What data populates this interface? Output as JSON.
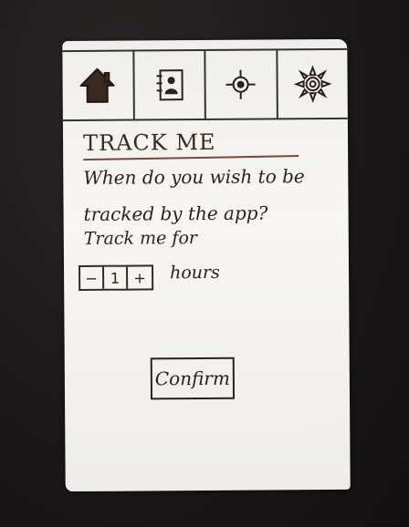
{
  "tabs": [
    {
      "icon": "home-icon"
    },
    {
      "icon": "address-book-icon"
    },
    {
      "icon": "location-target-icon"
    },
    {
      "icon": "settings-gear-icon"
    }
  ],
  "page": {
    "title": "TRACK ME",
    "question_line1": "When do you wish to be",
    "question_line2": "tracked by the app?",
    "track_label": "Track me for",
    "stepper": {
      "decrement": "−",
      "value": "1",
      "increment": "+"
    },
    "unit_label": "hours",
    "confirm_label": "Confirm"
  },
  "colors": {
    "paper": "#f7f6f3",
    "ink": "#2b221c",
    "underline": "#7a4a34",
    "background": "#1c1a1a"
  }
}
